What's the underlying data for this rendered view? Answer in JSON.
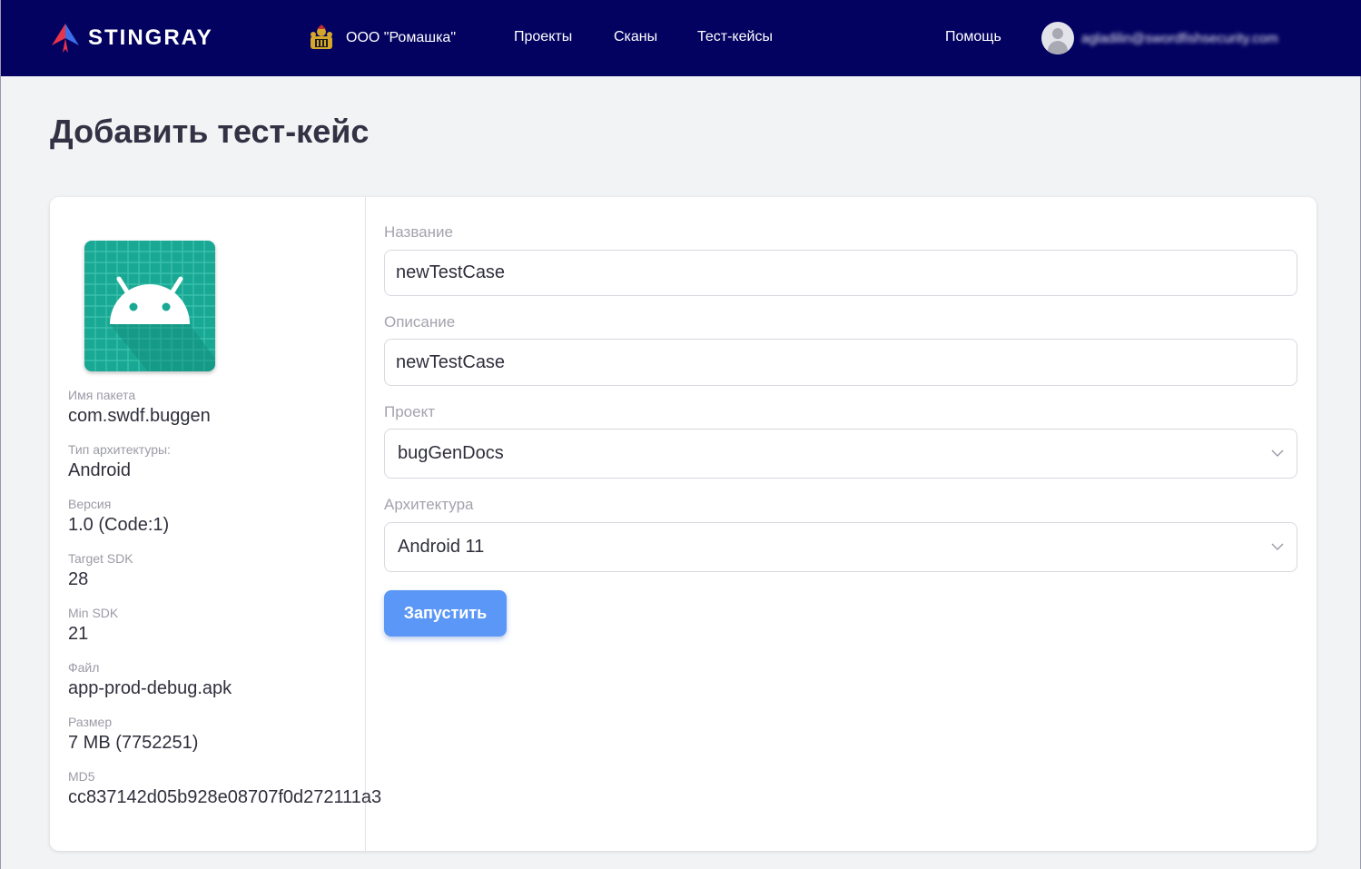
{
  "header": {
    "logo_text": "STINGRAY",
    "org_name": "ООО \"Ромашка\"",
    "nav": [
      {
        "label": "Проекты"
      },
      {
        "label": "Сканы"
      },
      {
        "label": "Тест-кейсы"
      }
    ],
    "help_label": "Помощь",
    "user_email": "agladilin@swordfishsecurity.com",
    "background_color": "#030261"
  },
  "page": {
    "title": "Добавить тест-кейс"
  },
  "app_info": {
    "icon": "android-app-icon",
    "items": [
      {
        "label": "Имя пакета",
        "value": "com.swdf.buggen"
      },
      {
        "label": "Тип архитектуры:",
        "value": "Android"
      },
      {
        "label": "Версия",
        "value": "1.0 (Code:1)"
      },
      {
        "label": "Target SDK",
        "value": "28"
      },
      {
        "label": "Min SDK",
        "value": "21"
      },
      {
        "label": "Файл",
        "value": "app-prod-debug.apk"
      },
      {
        "label": "Размер",
        "value": "7 MB (7752251)"
      },
      {
        "label": "MD5",
        "value": "cc837142d05b928e08707f0d272111a3"
      }
    ]
  },
  "form": {
    "name_label": "Название",
    "name_value": "newTestCase",
    "description_label": "Описание",
    "description_value": "newTestCase",
    "project_label": "Проект",
    "project_value": "bugGenDocs",
    "arch_label": "Архитектура",
    "arch_value": "Android 11",
    "submit_label": "Запустить",
    "submit_color": "#5b97f7"
  }
}
